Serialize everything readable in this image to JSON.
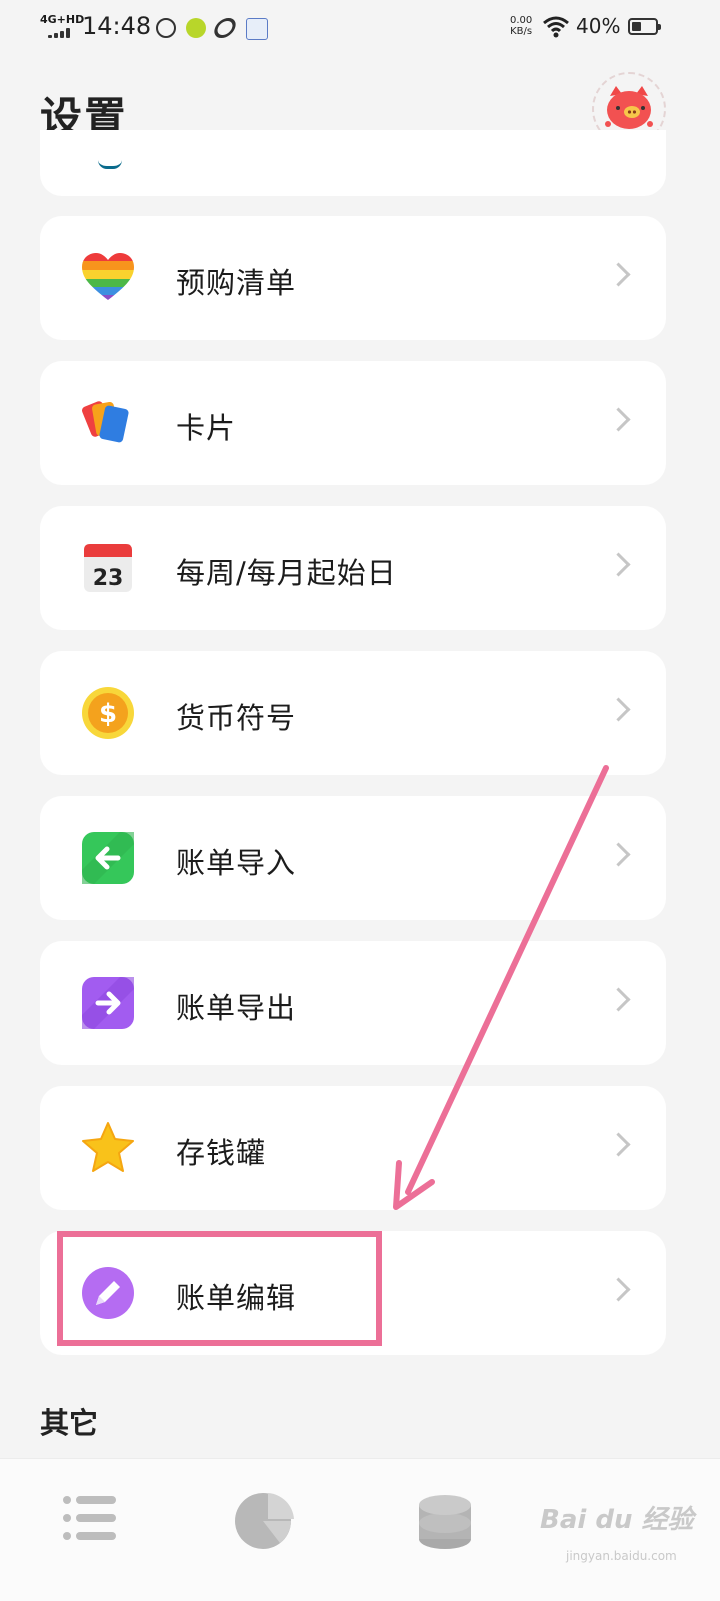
{
  "status_bar": {
    "network": "4G+HD",
    "time": "14:48",
    "speed_value": "0.00",
    "speed_unit": "KB/s",
    "battery": "40%",
    "battery_level": 0.4
  },
  "header": {
    "title": "设置"
  },
  "settings": {
    "items": [
      {
        "label": "预购清单",
        "icon": "rainbow-heart-icon"
      },
      {
        "label": "卡片",
        "icon": "cards-icon"
      },
      {
        "label": "每周/每月起始日",
        "icon": "calendar-icon",
        "icon_text": "23"
      },
      {
        "label": "货币符号",
        "icon": "dollar-coin-icon",
        "icon_text": "$"
      },
      {
        "label": "账单导入",
        "icon": "import-arrow-icon"
      },
      {
        "label": "账单导出",
        "icon": "export-arrow-icon"
      },
      {
        "label": "存钱罐",
        "icon": "star-icon"
      },
      {
        "label": "账单编辑",
        "icon": "pencil-icon"
      }
    ]
  },
  "section": {
    "other": "其它"
  },
  "bottom_nav": {
    "items": [
      "list-icon",
      "pie-chart-icon",
      "coins-stack-icon"
    ]
  },
  "watermark": {
    "text": "Bai du 经验",
    "sub": "jingyan.baidu.com"
  },
  "colors": {
    "annotation": "#ec6f97",
    "background": "#f4f4f4",
    "card": "#ffffff"
  }
}
